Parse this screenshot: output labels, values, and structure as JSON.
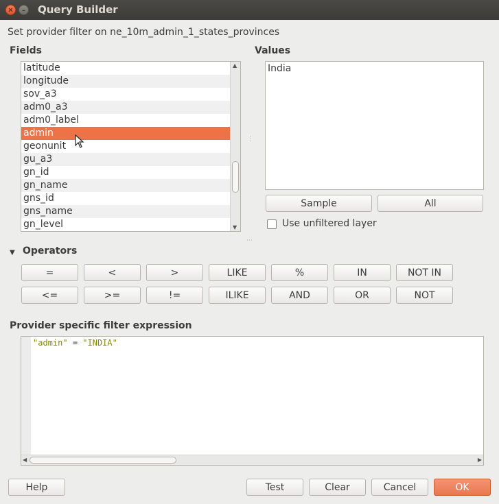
{
  "window": {
    "title": "Query Builder"
  },
  "description": "Set provider filter on ne_10m_admin_1_states_provinces",
  "fields": {
    "label": "Fields",
    "items": [
      "latitude",
      "longitude",
      "sov_a3",
      "adm0_a3",
      "adm0_label",
      "admin",
      "geonunit",
      "gu_a3",
      "gn_id",
      "gn_name",
      "gns_id",
      "gns_name",
      "gn_level"
    ],
    "selected": "admin"
  },
  "values": {
    "label": "Values",
    "items": [
      "India"
    ],
    "sample_label": "Sample",
    "all_label": "All",
    "unfiltered_label": "Use unfiltered layer"
  },
  "operators": {
    "label": "Operators",
    "row1": [
      "=",
      "<",
      ">",
      "LIKE",
      "%",
      "IN",
      "NOT IN"
    ],
    "row2": [
      "<=",
      ">=",
      "!=",
      "ILIKE",
      "AND",
      "OR",
      "NOT"
    ]
  },
  "expression": {
    "label": "Provider specific filter expression",
    "field": "\"admin\"",
    "operator": "=",
    "value": "\"INDIA\""
  },
  "buttons": {
    "help": "Help",
    "test": "Test",
    "clear": "Clear",
    "cancel": "Cancel",
    "ok": "OK"
  },
  "colors": {
    "accent": "#ec7348",
    "background": "#ededeb"
  }
}
